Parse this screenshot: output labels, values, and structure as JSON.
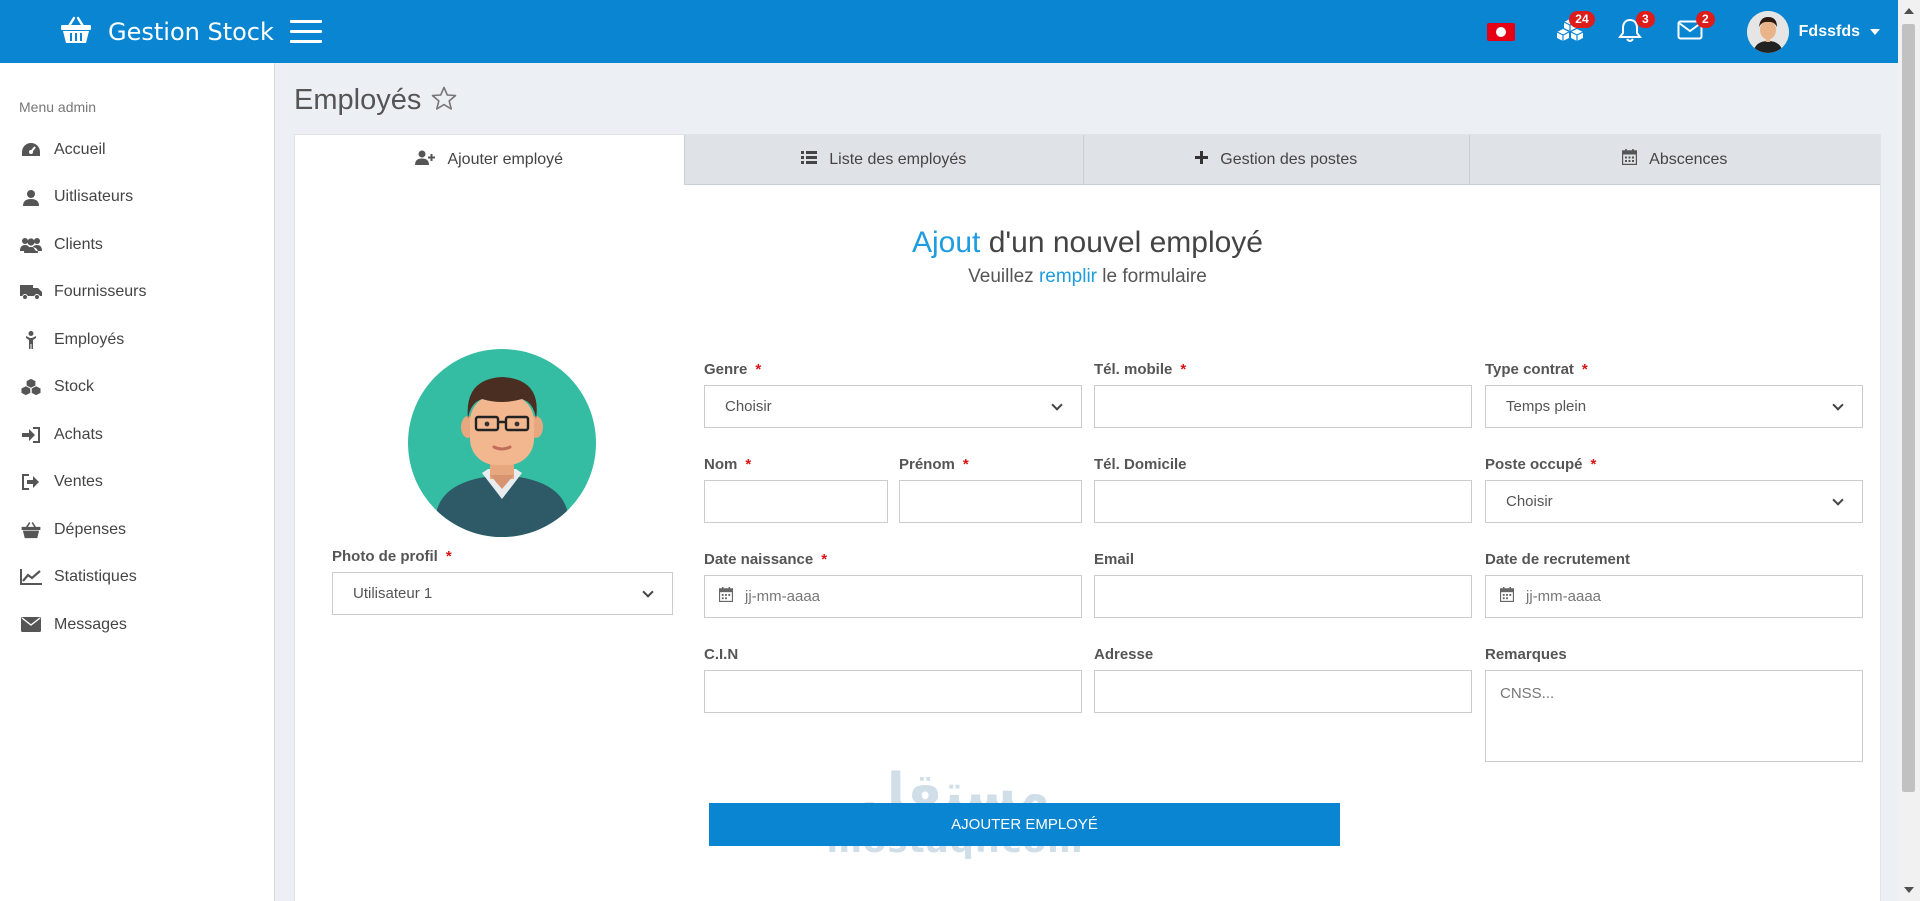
{
  "app": {
    "title": "Gestion Stock",
    "accent_color": "#0a85d1",
    "highlight_color": "#1e9ce0"
  },
  "topbar": {
    "flag": "tunisia-flag",
    "notifications": [
      {
        "icon": "cubes-icon",
        "count": "24"
      },
      {
        "icon": "bell-icon",
        "count": "3"
      },
      {
        "icon": "envelope-icon",
        "count": "2"
      }
    ],
    "user": {
      "name": "Fdssfds"
    }
  },
  "sidebar": {
    "header": "Menu admin",
    "items": [
      {
        "label": "Accueil",
        "icon": "dashboard-icon"
      },
      {
        "label": "Uitlisateurs",
        "icon": "user-icon"
      },
      {
        "label": "Clients",
        "icon": "users-icon"
      },
      {
        "label": "Fournisseurs",
        "icon": "truck-icon"
      },
      {
        "label": "Employés",
        "icon": "person-icon"
      },
      {
        "label": "Stock",
        "icon": "cubes-icon"
      },
      {
        "label": "Achats",
        "icon": "sign-in-icon"
      },
      {
        "label": "Ventes",
        "icon": "sign-out-icon"
      },
      {
        "label": "Dépenses",
        "icon": "basket-icon"
      },
      {
        "label": "Statistiques",
        "icon": "line-chart-icon"
      },
      {
        "label": "Messages",
        "icon": "envelope-icon"
      }
    ]
  },
  "page": {
    "title": "Employés"
  },
  "tabs": [
    {
      "label": "Ajouter employé",
      "icon": "user-plus-icon",
      "active": true
    },
    {
      "label": "Liste des employés",
      "icon": "list-icon",
      "active": false
    },
    {
      "label": "Gestion des postes",
      "icon": "plus-icon",
      "active": false
    },
    {
      "label": "Abscences",
      "icon": "calendar-icon",
      "active": false
    }
  ],
  "form": {
    "heading_highlight": "Ajout",
    "heading_rest": " d'un nouvel employé",
    "sub_pre": "Veuillez ",
    "sub_highlight": "remplir",
    "sub_post": " le formulaire",
    "profile_label": "Photo de profil",
    "profile_value": "Utilisateur 1",
    "genre_label": "Genre",
    "genre_value": "Choisir",
    "tel_mobile_label": "Tél. mobile",
    "type_contrat_label": "Type contrat",
    "type_contrat_value": "Temps plein",
    "nom_label": "Nom",
    "prenom_label": "Prénom",
    "tel_domicile_label": "Tél. Domicile",
    "poste_label": "Poste occupé",
    "poste_value": "Choisir",
    "date_naissance_label": "Date naissance",
    "date_placeholder": "jj-mm-aaaa",
    "email_label": "Email",
    "date_recrutement_label": "Date de recrutement",
    "cin_label": "C.I.N",
    "adresse_label": "Adresse",
    "remarques_label": "Remarques",
    "remarques_placeholder": "CNSS...",
    "required_mark": "*",
    "submit_label": "AJOUTER EMPLOYÉ"
  },
  "watermark": {
    "arabic": "مستقل",
    "latin": "mostaql.com"
  }
}
